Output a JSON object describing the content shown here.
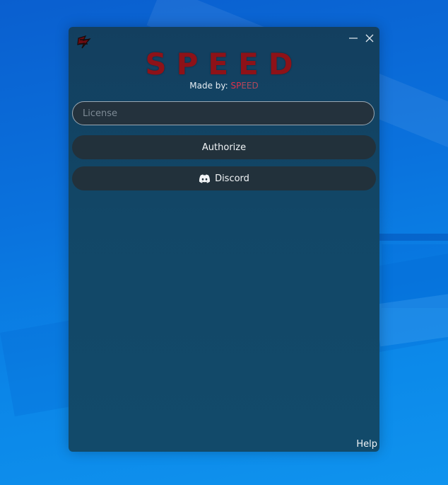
{
  "window": {
    "title": "SPEED",
    "made_by_prefix": "Made by: ",
    "made_by_brand_a": "SP",
    "made_by_brand_b": "EED"
  },
  "license": {
    "placeholder": "License",
    "value": ""
  },
  "buttons": {
    "authorize": "Authorize",
    "discord": "Discord"
  },
  "footer": {
    "help": "Help"
  },
  "icons": {
    "app_logo": "speed-logo-icon",
    "minimize": "minimize-icon",
    "close": "close-icon",
    "discord": "discord-icon"
  },
  "colors": {
    "title": "#8e1218",
    "brand_accent": "#e0304a",
    "window_bg": "#133f5f",
    "button_bg": "#22313b"
  }
}
